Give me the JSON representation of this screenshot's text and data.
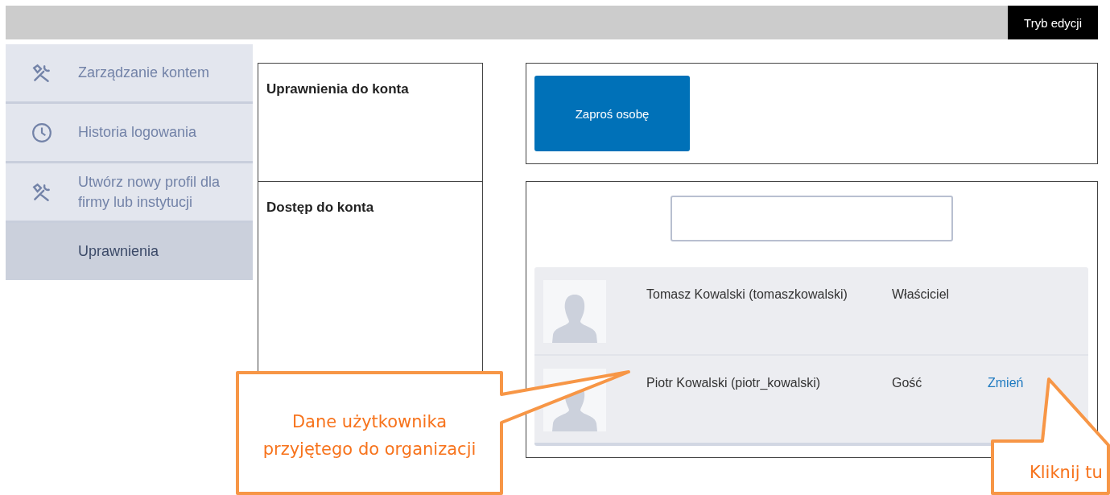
{
  "top_bar": {
    "edit_mode_button": "Tryb edycji"
  },
  "sidebar": {
    "items": [
      {
        "label": "Zarządzanie kontem",
        "kind": "tools",
        "selected": false
      },
      {
        "label": "Historia logowania",
        "kind": "history",
        "selected": false
      },
      {
        "label": "Utwórz nowy profil dla firmy lub instytucji",
        "kind": "tools",
        "selected": false
      },
      {
        "label": "Uprawnienia",
        "kind": "plain",
        "selected": true
      }
    ]
  },
  "sections": [
    {
      "title": "Uprawnienia do konta",
      "kind": "invite",
      "button": "Zaproś osobę"
    },
    {
      "title": "Dostęp do konta",
      "kind": "members",
      "members": [
        {
          "name": "Tomasz Kowalski (tomaszkowalski)",
          "role": "Właściciel"
        },
        {
          "name": "Piotr Kowalski (piotr_kowalski)",
          "role": "Gość",
          "action": "Zmień"
        }
      ]
    }
  ],
  "callouts": [
    {
      "lines": [
        "Dane użytkownika",
        "przyjętego do organizacji"
      ]
    },
    {
      "lines": [
        "Kliknij tu"
      ]
    }
  ]
}
